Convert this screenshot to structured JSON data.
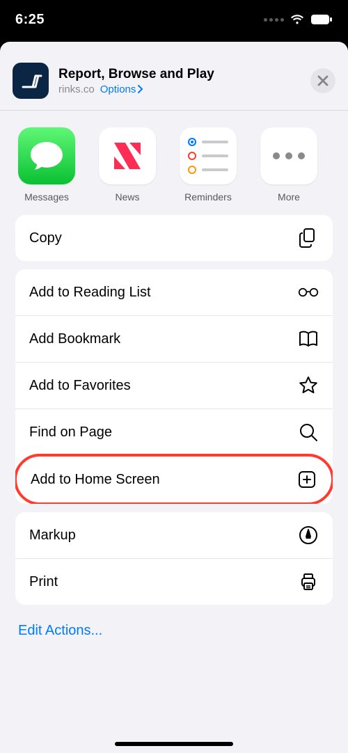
{
  "status": {
    "time": "6:25"
  },
  "header": {
    "title": "Report, Browse and Play",
    "domain": "rinks.co",
    "options_label": "Options"
  },
  "app_targets": {
    "messages": "Messages",
    "news": "News",
    "reminders": "Reminders",
    "more": "More"
  },
  "actions": {
    "copy": "Copy",
    "reading_list": "Add to Reading List",
    "bookmark": "Add Bookmark",
    "favorites": "Add to Favorites",
    "find": "Find on Page",
    "home_screen": "Add to Home Screen",
    "markup": "Markup",
    "print": "Print"
  },
  "edit_actions": "Edit Actions..."
}
